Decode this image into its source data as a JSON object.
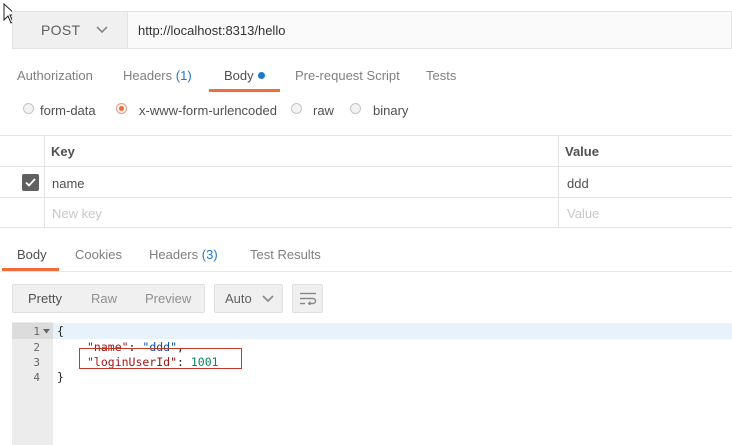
{
  "request": {
    "method": "POST",
    "url": "http://localhost:8313/hello"
  },
  "request_tabs": [
    {
      "label": "Authorization"
    },
    {
      "label": "Headers",
      "count": "(1)"
    },
    {
      "label": "Body",
      "active": true
    },
    {
      "label": "Pre-request Script"
    },
    {
      "label": "Tests"
    }
  ],
  "body_types": [
    {
      "label": "form-data",
      "selected": false
    },
    {
      "label": "x-www-form-urlencoded",
      "selected": true
    },
    {
      "label": "raw",
      "selected": false
    },
    {
      "label": "binary",
      "selected": false
    }
  ],
  "params_table": {
    "headers": {
      "key": "Key",
      "value": "Value"
    },
    "rows": [
      {
        "key": "name",
        "value": "ddd",
        "checked": true
      }
    ],
    "placeholder": {
      "key": "New key",
      "value": "Value"
    }
  },
  "response_tabs": [
    {
      "label": "Body",
      "active": true
    },
    {
      "label": "Cookies"
    },
    {
      "label": "Headers",
      "count": "(3)"
    },
    {
      "label": "Test Results"
    }
  ],
  "view_modes": {
    "pretty": "Pretty",
    "raw": "Raw",
    "preview": "Preview",
    "selected": "Pretty"
  },
  "format_select": {
    "value": "Auto"
  },
  "response_body": {
    "line_numbers": [
      "1",
      "2",
      "3",
      "4"
    ],
    "lines": [
      "{",
      "\"name\": \"ddd\",",
      "\"loginUserId\": 1001",
      "}"
    ],
    "open_brace": "{",
    "name_key": "\"name\"",
    "name_value": "\"ddd\"",
    "login_key": "\"loginUserId\"",
    "login_value": "1001",
    "close_brace": "}"
  },
  "colors": {
    "accent": "#f26b3a",
    "link": "#1f78c8",
    "highlight_box": "#c0392b"
  }
}
